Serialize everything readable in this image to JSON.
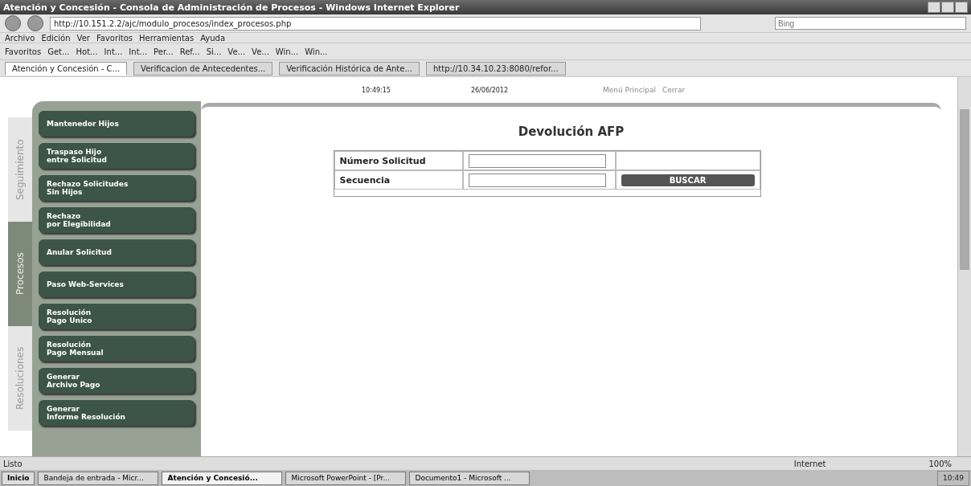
{
  "window": {
    "title": "Atención y Concesión - Consola de Administración de Procesos - Windows Internet Explorer"
  },
  "address": {
    "url": "http://10.151.2.2/ajc/modulo_procesos/index_procesos.php",
    "search_placeholder": "Bing"
  },
  "menu": [
    "Archivo",
    "Edición",
    "Ver",
    "Favoritos",
    "Herramientas",
    "Ayuda"
  ],
  "favorites": {
    "label": "Favoritos",
    "items": [
      "Get...",
      "Hot...",
      "Int...",
      "Int...",
      "Per...",
      "Ref...",
      "Si...",
      "Ve...",
      "Ve...",
      "Win...",
      "Win..."
    ]
  },
  "browser_tabs": [
    {
      "label": "Atención y Concesión - C...",
      "selected": true
    },
    {
      "label": "Verificacion de Antecedentes...",
      "selected": false
    },
    {
      "label": "Verificación Histórica de Ante...",
      "selected": false
    },
    {
      "label": "http://10.34.10.23:8080/refor...",
      "selected": false
    }
  ],
  "header": {
    "time": "10:49:15",
    "date": "26/06/2012",
    "links": [
      "Menú Principal",
      "Cerrar"
    ]
  },
  "side_tabs": [
    {
      "label": "Seguimiento",
      "selected": false
    },
    {
      "label": "Procesos",
      "selected": true
    },
    {
      "label": "Resoluciones",
      "selected": false
    }
  ],
  "sidebar": {
    "items": [
      "Mantenedor Hijos",
      "Traspaso Hijo\nentre Solicitud",
      "Rechazo Solicitudes\nSin Hijos",
      "Rechazo\npor Elegibilidad",
      "Anular Solicitud",
      "Paso Web-Services",
      "Resolución\nPago Unico",
      "Resolución\nPago Mensual",
      "Generar\nArchivo Pago",
      "Generar\nInforme Resolución"
    ]
  },
  "form": {
    "title": "Devolución AFP",
    "fields": [
      {
        "label": "Número Solicitud"
      },
      {
        "label": "Secuencia"
      }
    ],
    "button": "BUSCAR"
  },
  "status_bar": {
    "text": "Listo",
    "zone": "Internet",
    "zoom": "100%"
  },
  "taskbar": {
    "start": "Inicio",
    "items": [
      {
        "label": "Bandeja de entrada - Micr...",
        "selected": false
      },
      {
        "label": "Atención y Concesió...",
        "selected": true
      },
      {
        "label": "Microsoft PowerPoint - [Pr...",
        "selected": false
      },
      {
        "label": "Documento1 - Microsoft ...",
        "selected": false
      }
    ],
    "clock": "10:49"
  }
}
